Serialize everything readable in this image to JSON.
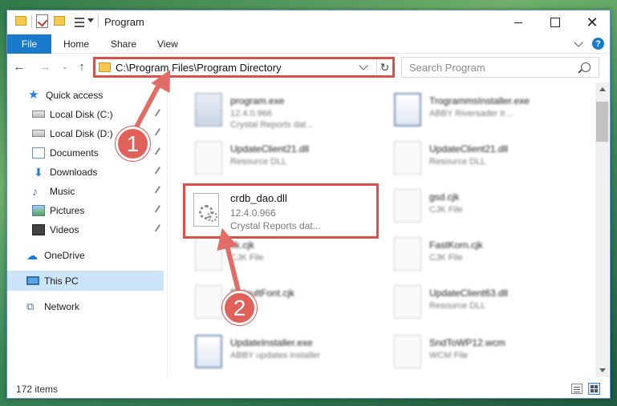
{
  "window": {
    "title": "Program",
    "close_glyph": "✕"
  },
  "ribbon": {
    "tabs": [
      "File",
      "Home",
      "Share",
      "View"
    ],
    "help_glyph": "?"
  },
  "address_bar": {
    "path": "C:\\Program Files\\Program Directory",
    "refresh_glyph": "↻"
  },
  "nav_buttons": {
    "back": "←",
    "forward": "→",
    "recent": "⌄",
    "up": "↑"
  },
  "search": {
    "placeholder": "Search Program"
  },
  "nav_pane": {
    "items": [
      {
        "label": "Quick access",
        "icon": "star-icon"
      },
      {
        "label": "Local Disk (C:)",
        "icon": "disk-icon",
        "pinned": true
      },
      {
        "label": "Local Disk (D:)",
        "icon": "disk-icon",
        "pinned": true
      },
      {
        "label": "Documents",
        "icon": "documents-icon",
        "pinned": true
      },
      {
        "label": "Downloads",
        "icon": "download-icon",
        "pinned": true
      },
      {
        "label": "Music",
        "icon": "music-icon",
        "pinned": true
      },
      {
        "label": "Pictures",
        "icon": "pictures-icon",
        "pinned": true
      },
      {
        "label": "Videos",
        "icon": "videos-icon",
        "pinned": true
      },
      {
        "label": "OneDrive",
        "icon": "cloud-icon"
      },
      {
        "label": "This PC",
        "icon": "computer-icon",
        "selected": true
      },
      {
        "label": "Network",
        "icon": "network-icon"
      }
    ],
    "glyphs": {
      "star": "★",
      "download": "⬇",
      "music": "♪",
      "cloud": "☁",
      "network": "⧉"
    }
  },
  "files": [
    {
      "name": "program.exe",
      "line2": "12.4.0.966",
      "line3": "Crystal Reports dat..."
    },
    {
      "name": "TrogrammsInstaller.exe",
      "line2": "ABBY Riversader tr...",
      "line3": ""
    },
    {
      "name": "UpdateClient21.dll",
      "line2": "Resource DLL",
      "line3": ""
    },
    {
      "name": "UpdateClient21.dll",
      "line2": "Resource DLL",
      "line3": ""
    },
    {
      "name": "gsd.cjk",
      "line2": "CJK File",
      "line3": ""
    },
    {
      "name": "fik.cjk",
      "line2": "CJK File",
      "line3": ""
    },
    {
      "name": "FastKorn.cjk",
      "line2": "CJK File",
      "line3": ""
    },
    {
      "name": "DefaultFont.cjk",
      "line2": "",
      "line3": ""
    },
    {
      "name": "UpdateClient63.dll",
      "line2": "Resource DLL",
      "line3": ""
    },
    {
      "name": "UpdateInstaller.exe",
      "line2": "ABBY updates installer",
      "line3": ""
    },
    {
      "name": "SndToWP12.wcm",
      "line2": "WCM File",
      "line3": ""
    }
  ],
  "highlighted_file": {
    "name": "crdb_dao.dll",
    "version": "12.4.0.966",
    "description": "Crystal Reports dat..."
  },
  "callouts": {
    "step1": "1",
    "step2": "2",
    "color": "#e0605a"
  },
  "status_bar": {
    "item_count": "172 items"
  }
}
